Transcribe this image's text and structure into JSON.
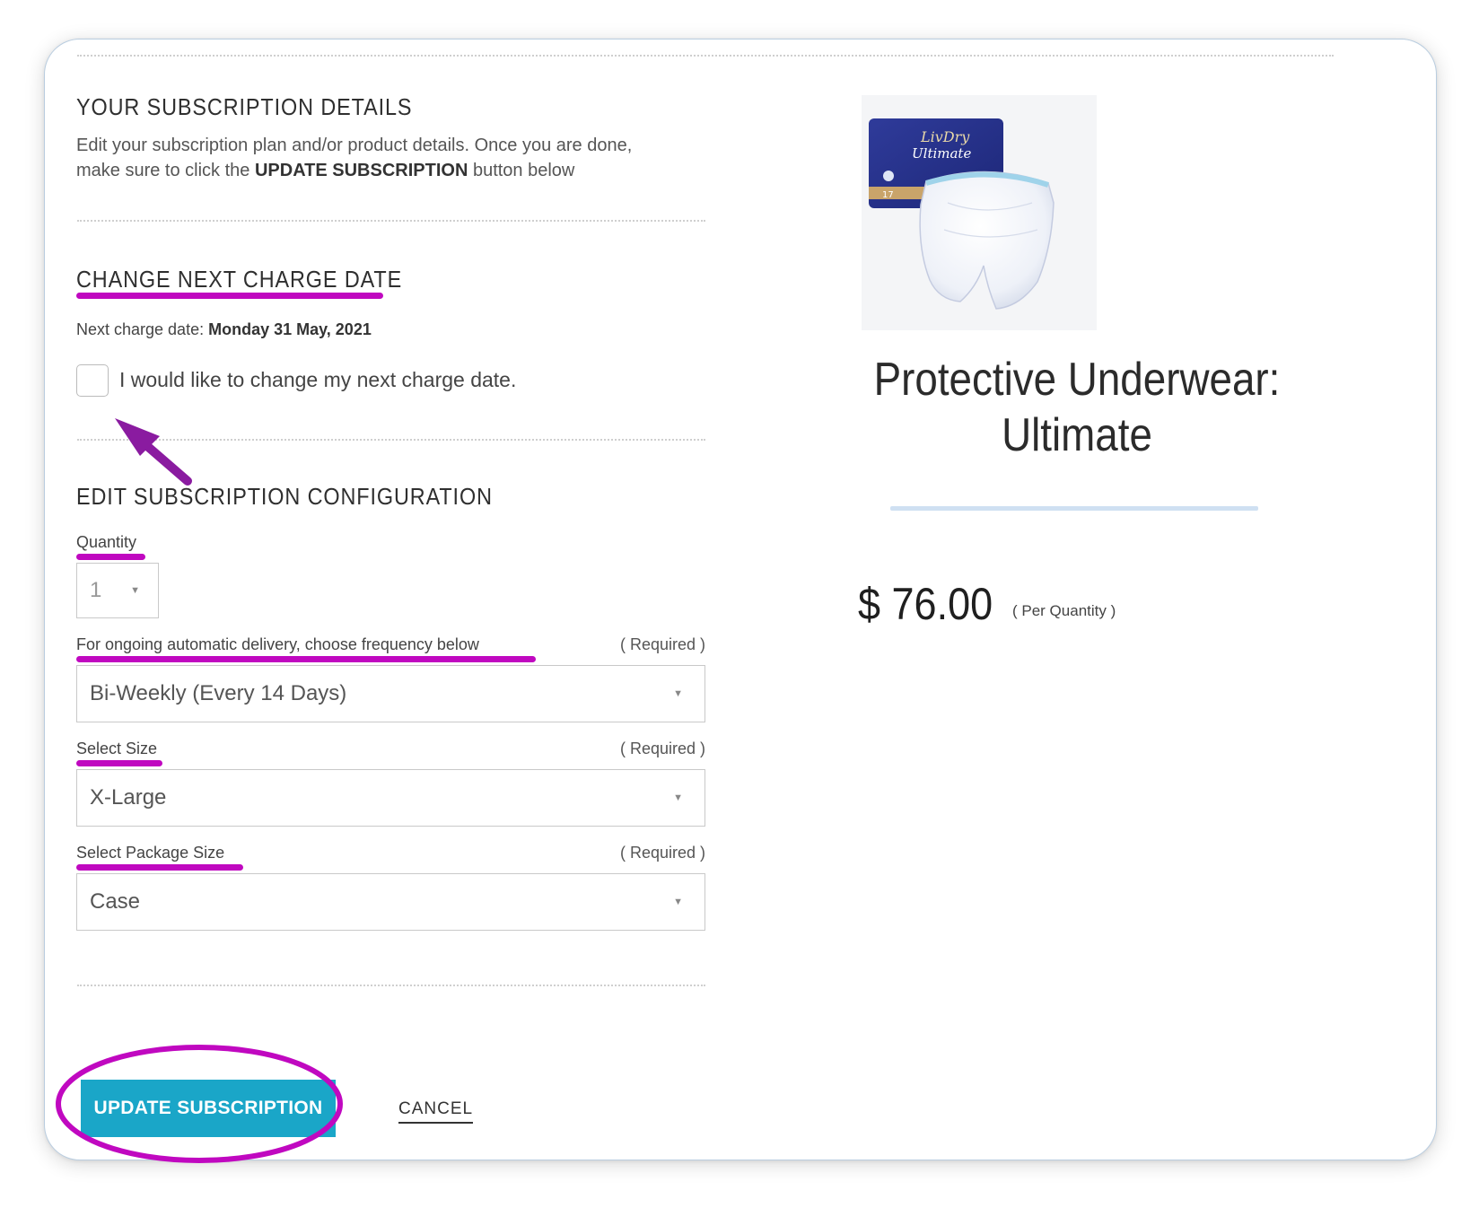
{
  "subscription": {
    "heading": "YOUR SUBSCRIPTION DETAILS",
    "description_line1": "Edit your subscription plan and/or product details. Once you are done,",
    "description_prefix": "make sure to click the ",
    "description_emphasis": "UPDATE SUBSCRIPTION",
    "description_suffix": " button below"
  },
  "charge_date": {
    "heading": "CHANGE NEXT CHARGE DATE",
    "label": "Next charge date: ",
    "value": "Monday 31 May, 2021",
    "checkbox_label": "I would like to change my next charge date.",
    "checkbox_checked": false
  },
  "configuration": {
    "heading": "EDIT SUBSCRIPTION CONFIGURATION",
    "quantity": {
      "label": "Quantity",
      "value": "1"
    },
    "frequency": {
      "label": "For ongoing automatic delivery, choose frequency below",
      "required": "( Required )",
      "value": "Bi-Weekly (Every 14 Days)"
    },
    "size": {
      "label": "Select Size",
      "required": "( Required )",
      "value": "X-Large"
    },
    "package_size": {
      "label": "Select Package Size",
      "required": "( Required )",
      "value": "Case"
    }
  },
  "actions": {
    "update_label": "UPDATE SUBSCRIPTION",
    "cancel_label": "CANCEL"
  },
  "product": {
    "title_line1": "Protective Underwear:",
    "title_line2": "Ultimate",
    "price": "$ 76.00",
    "price_note": "( Per Quantity )",
    "package_brand": "LivDry",
    "package_name": "Ultimate",
    "package_count": "17"
  },
  "colors": {
    "accent": "#1aa6c8",
    "highlight": "#c008c0",
    "divider": "#cfe0f2"
  }
}
